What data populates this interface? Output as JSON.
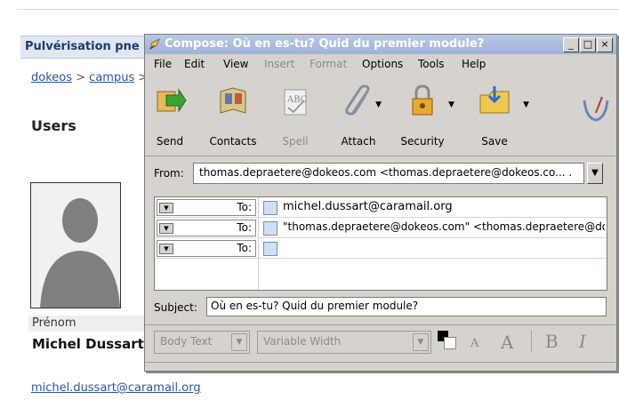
{
  "background_page": {
    "header_title": "Pulvérisation pne",
    "breadcrumb": {
      "item1": "dokeos",
      "separator1": " > ",
      "item2": "campus",
      "separator2": " >"
    },
    "section_heading": "Users",
    "field_label": "Prénom",
    "user_name": "Michel Dussart",
    "user_email": "michel.dussart@caramail.org"
  },
  "compose_window": {
    "title": "Compose: Où en es-tu? Quid du premier module?",
    "window_buttons": {
      "minimize": "_",
      "maximize": "□",
      "close": "×"
    },
    "menu": [
      "File",
      "Edit",
      "View",
      "Insert",
      "Format",
      "Options",
      "Tools",
      "Help"
    ],
    "disabled_menu_items": [
      "Insert",
      "Format"
    ],
    "toolbar": {
      "send": "Send",
      "contacts": "Contacts",
      "spell": "Spell",
      "attach": "Attach",
      "security": "Security",
      "save": "Save"
    },
    "from": {
      "label": "From:",
      "value": "thomas.depraetere@dokeos.com <thomas.depraetere@dokeos.co...   ..."
    },
    "recipients": [
      {
        "type": "To:",
        "value": "michel.dussart@caramail.org"
      },
      {
        "type": "To:",
        "value": "\"thomas.depraetere@dokeos.com\" <thomas.depraetere@doke"
      },
      {
        "type": "To:",
        "value": ""
      }
    ],
    "subject": {
      "label": "Subject:",
      "value": "Où en es-tu? Quid du premier module?"
    },
    "format_toolbar": {
      "paragraph_style": "Body Text",
      "font": "Variable Width",
      "smaller_text": "A",
      "larger_text": "A",
      "bold": "B",
      "italic": "I"
    }
  },
  "colors": {
    "titlebar_gradient_top": "#b8c8e6",
    "titlebar_gradient_bottom": "#9eb3d8",
    "window_face": "#d6d3ce",
    "link": "#2a55a8"
  }
}
